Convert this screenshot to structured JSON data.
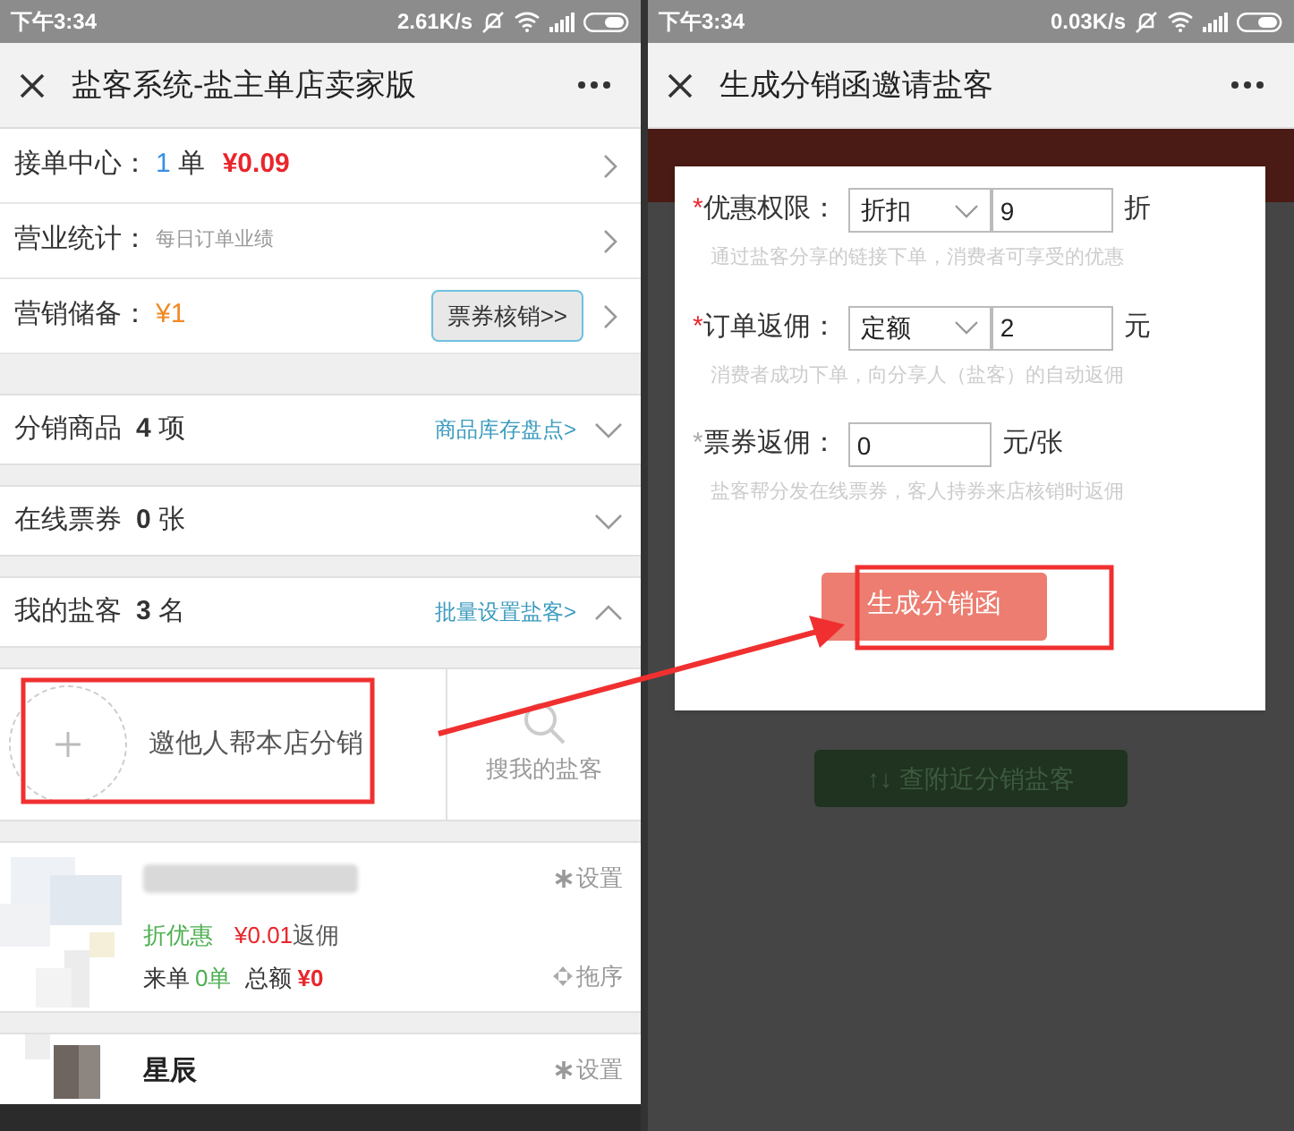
{
  "left": {
    "status_bar": {
      "time": "下午3:34",
      "speed": "2.61K/s"
    },
    "title": "盐客系统-盐主单店卖家版",
    "summary_rows": [
      {
        "kind": "orders",
        "label": "接单中心：",
        "count": "1",
        "unit": "单",
        "amount": "¥0.09"
      },
      {
        "kind": "stats",
        "label": "营业统计：",
        "hint": "每日订单业绩"
      },
      {
        "kind": "reserve",
        "label": "营销储备：",
        "amount": "¥1",
        "button": "票券核销>>"
      }
    ],
    "sections": [
      {
        "label": "分销商品",
        "count": "4",
        "unit": "项",
        "link": "商品库存盘点>",
        "expanded": false
      },
      {
        "label": "在线票券",
        "count": "0",
        "unit": "张",
        "expanded": false
      },
      {
        "label": "我的盐客",
        "count": "3",
        "unit": "名",
        "link": "批量设置盐客>",
        "expanded": true
      }
    ],
    "invite": {
      "label": "邀他人帮本店分销",
      "search": "搜我的盐客"
    },
    "agents": [
      {
        "kind": "detailed",
        "discount": "折优惠",
        "commission": "¥0.01",
        "commission_label": "返佣",
        "orders_label": "来单",
        "orders": "0单",
        "total_label": "总额",
        "total": "¥0",
        "settings": "设置",
        "sort": "拖序"
      },
      {
        "kind": "short",
        "name": "星辰",
        "settings": "设置"
      }
    ]
  },
  "right": {
    "status_bar": {
      "time": "下午3:34",
      "speed": "0.03K/s"
    },
    "title": "生成分销函邀请盐客",
    "background_button": "↑↓ 查附近分销盐客",
    "dialog": {
      "fields": [
        {
          "kind": "select",
          "marker": "*",
          "required": true,
          "label": "优惠权限：",
          "option": "折扣",
          "value": "9",
          "unit": "折",
          "hint": "通过盐客分享的链接下单，消费者可享受的优惠"
        },
        {
          "kind": "select",
          "marker": "*",
          "required": true,
          "label": "订单返佣：",
          "option": "定额",
          "value": "2",
          "unit": "元",
          "hint": "消费者成功下单，向分享人（盐客）的自动返佣"
        },
        {
          "kind": "input",
          "marker": "*",
          "required": false,
          "label": "票券返佣：",
          "value": "0",
          "unit": "元/张",
          "hint": "盐客帮分发在线票券，客人持券来店核销时返佣"
        }
      ],
      "submit": "生成分销函"
    }
  }
}
